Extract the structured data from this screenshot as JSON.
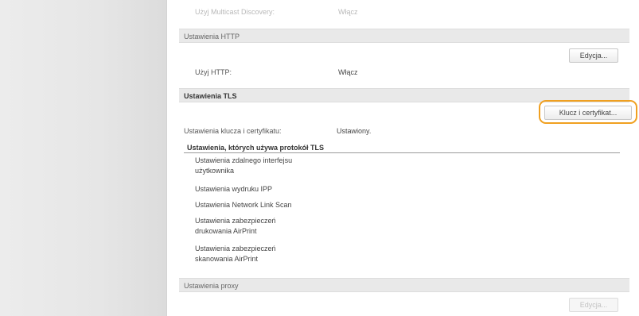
{
  "multicast": {
    "label": "Użyj Multicast Discovery:",
    "value": "Włącz"
  },
  "http": {
    "header": "Ustawienia HTTP",
    "edit_button": "Edycja...",
    "label": "Użyj HTTP:",
    "value": "Włącz"
  },
  "tls": {
    "header": "Ustawienia TLS",
    "key_button": "Klucz i certyfikat...",
    "key_label": "Ustawienia klucza i certyfikatu:",
    "key_value": "Ustawiony.",
    "protocol_heading": "Ustawienia, których używa protokół TLS",
    "protocol_items": [
      {
        "line1": "Ustawienia zdalnego interfejsu",
        "line2": "użytkownika"
      },
      {
        "line1": "Ustawienia wydruku IPP",
        "line2": ""
      },
      {
        "line1": "Ustawienia Network Link Scan",
        "line2": ""
      },
      {
        "line1": "Ustawienia zabezpieczeń",
        "line2": "drukowania AirPrint"
      },
      {
        "line1": "Ustawienia zabezpieczeń",
        "line2": "skanowania AirPrint"
      }
    ]
  },
  "proxy": {
    "header": "Ustawienia proxy",
    "edit_button": "Edycja..."
  },
  "colors": {
    "highlight": "#f0a020"
  }
}
